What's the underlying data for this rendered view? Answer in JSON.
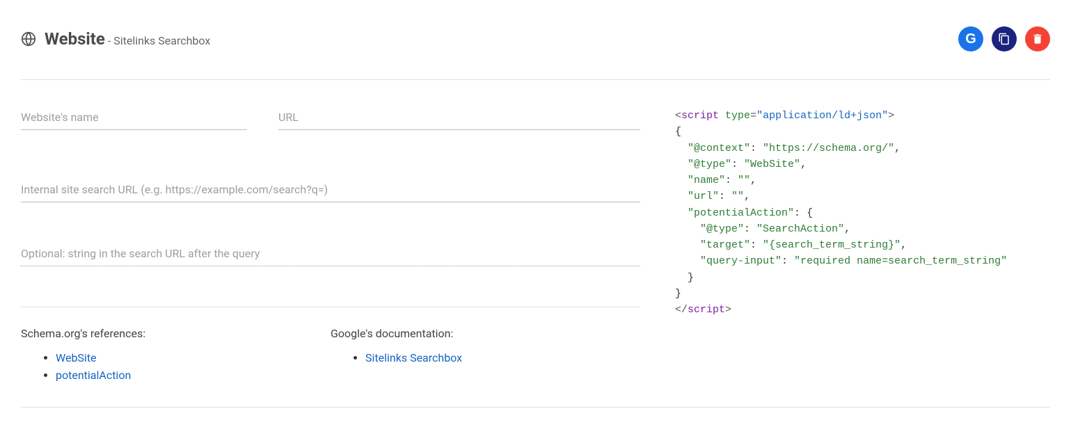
{
  "header": {
    "title_main": "Website",
    "title_sub": "- Sitelinks Searchbox"
  },
  "actions": {
    "google_letter": "G"
  },
  "inputs": {
    "name_placeholder": "Website's name",
    "url_placeholder": "URL",
    "search_url_placeholder": "Internal site search URL (e.g. https://example.com/search?q=)",
    "optional_placeholder": "Optional: string in the search URL after the query"
  },
  "refs": {
    "schema_heading": "Schema.org's references:",
    "schema_links": {
      "website": "WebSite",
      "potential_action": "potentialAction"
    },
    "google_heading": "Google's documentation:",
    "google_links": {
      "sitelinks": "Sitelinks Searchbox"
    }
  },
  "code": {
    "open_tag_name": "script",
    "type_attr": "type",
    "type_val": "\"application/ld+json\"",
    "line_open_brace": "{",
    "line_context_k": "\"@context\"",
    "line_context_v": "\"https://schema.org/\"",
    "line_type_k": "\"@type\"",
    "line_type_v": "\"WebSite\"",
    "line_name_k": "\"name\"",
    "line_name_v": "\"\"",
    "line_url_k": "\"url\"",
    "line_url_v": "\"\"",
    "line_pa_k": "\"potentialAction\"",
    "line_pa_open": "{",
    "line_pa_type_k": "\"@type\"",
    "line_pa_type_v": "\"SearchAction\"",
    "line_target_k": "\"target\"",
    "line_target_v": "\"{search_term_string}\"",
    "line_qi_k": "\"query-input\"",
    "line_qi_v": "\"required name=search_term_string\"",
    "line_pa_close": "}",
    "line_close_brace": "}",
    "close_tag_name": "script"
  }
}
